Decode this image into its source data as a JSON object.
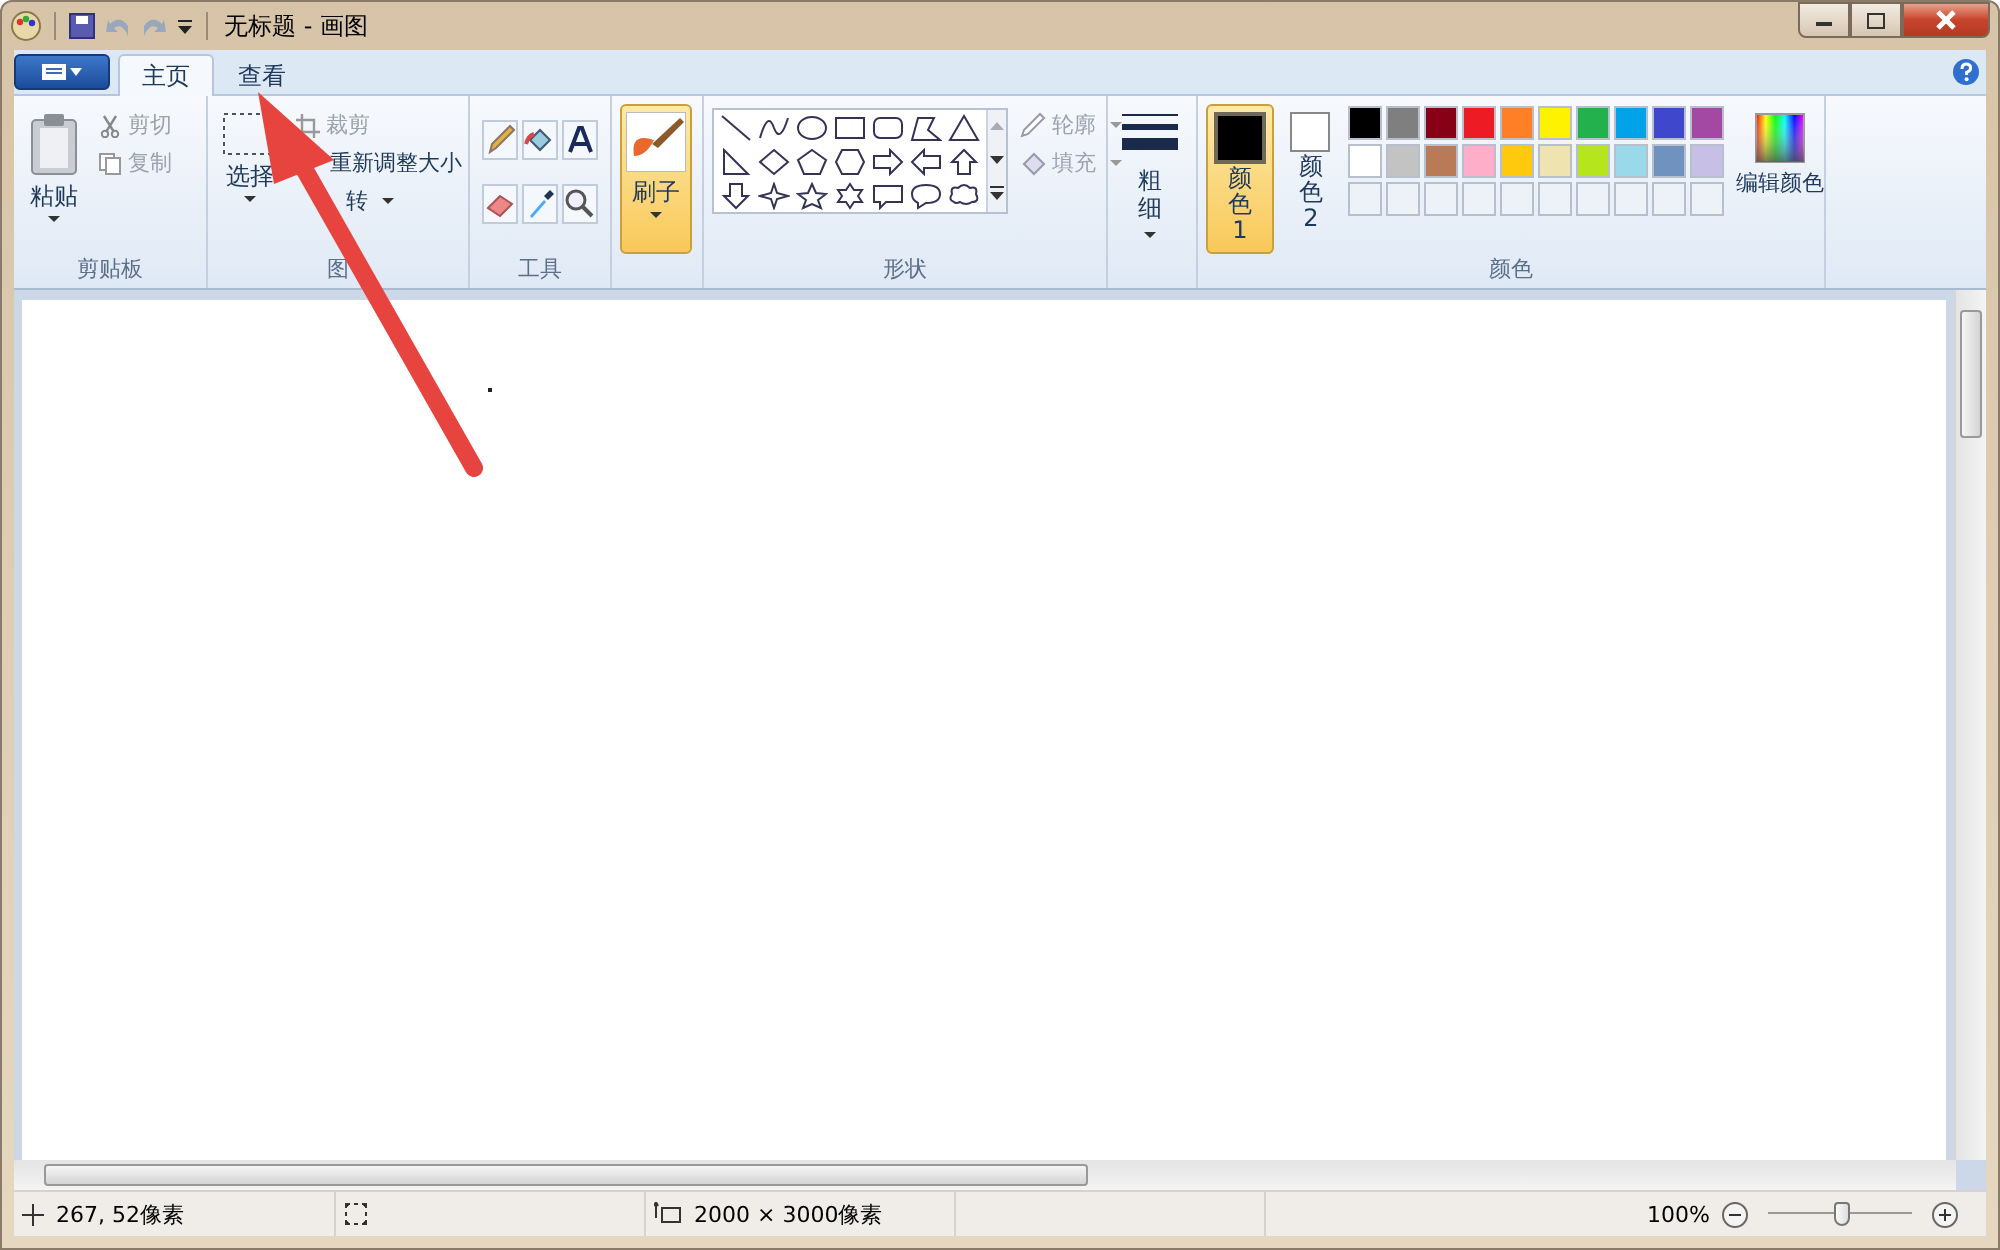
{
  "window": {
    "title": "无标题 - 画图"
  },
  "tabs": [
    {
      "label": "主页",
      "selected": true
    },
    {
      "label": "查看",
      "selected": false
    }
  ],
  "ribbon": {
    "clipboard": {
      "label": "剪贴板",
      "paste": "粘贴",
      "cut": {
        "label": "剪切",
        "disabled": true
      },
      "copy": {
        "label": "复制",
        "disabled": true
      }
    },
    "image": {
      "label": "图",
      "select": "选择",
      "crop": {
        "label": "裁剪",
        "disabled": true
      },
      "resize": {
        "label": "重新调整大小",
        "disabled": false
      },
      "rotate": {
        "label": "转",
        "disabled": false
      }
    },
    "tools": {
      "label": "工具"
    },
    "brushes": {
      "label": "刷子",
      "selected": true
    },
    "shapes": {
      "label": "形状",
      "outline": {
        "label": "轮廓",
        "disabled": true
      },
      "fill": {
        "label": "填充",
        "disabled": true
      }
    },
    "size": {
      "label": "粗细"
    },
    "colors": {
      "label": "颜色",
      "color1": {
        "label": "颜色 1",
        "selected": true
      },
      "color2": {
        "label": "颜色 2",
        "selected": false
      },
      "edit": "编辑颜色",
      "palette": [
        {
          "kind": "color",
          "color": "#000000"
        },
        {
          "kind": "color",
          "color": "#7f7f7f"
        },
        {
          "kind": "color",
          "color": "#880015"
        },
        {
          "kind": "color",
          "color": "#ed1c24"
        },
        {
          "kind": "color",
          "color": "#ff7f27"
        },
        {
          "kind": "color",
          "color": "#fff200"
        },
        {
          "kind": "color",
          "color": "#22b14c"
        },
        {
          "kind": "color",
          "color": "#00a2e8"
        },
        {
          "kind": "color",
          "color": "#3f48cc"
        },
        {
          "kind": "color",
          "color": "#a349a4"
        },
        {
          "kind": "color",
          "color": "#ffffff"
        },
        {
          "kind": "color",
          "color": "#c3c3c3"
        },
        {
          "kind": "color",
          "color": "#b97a57"
        },
        {
          "kind": "color",
          "color": "#ffaec9"
        },
        {
          "kind": "color",
          "color": "#ffc90e"
        },
        {
          "kind": "color",
          "color": "#efe4b0"
        },
        {
          "kind": "color",
          "color": "#b5e61d"
        },
        {
          "kind": "color",
          "color": "#99d9ea"
        },
        {
          "kind": "color",
          "color": "#7092be"
        },
        {
          "kind": "color",
          "color": "#c8bfe7"
        },
        {
          "kind": "empty"
        },
        {
          "kind": "empty"
        },
        {
          "kind": "empty"
        },
        {
          "kind": "empty"
        },
        {
          "kind": "empty"
        },
        {
          "kind": "empty"
        },
        {
          "kind": "empty"
        },
        {
          "kind": "empty"
        },
        {
          "kind": "empty"
        },
        {
          "kind": "empty"
        }
      ]
    }
  },
  "status_bar": {
    "position": "267, 52像素",
    "canvas_size": "2000 × 3000像素",
    "zoom": "100%",
    "zoom_slider": {
      "level": 0.52
    }
  }
}
